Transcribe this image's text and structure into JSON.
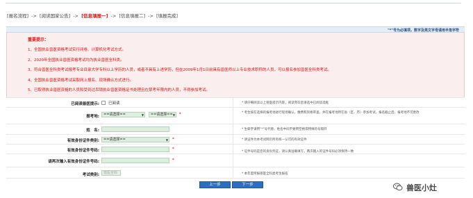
{
  "breadcrumb": {
    "steps": [
      {
        "label": "[报名流程]"
      },
      {
        "label": "[阅读国家公告]"
      },
      {
        "label": "[信息填报一]"
      },
      {
        "label": "[信息填报二]"
      },
      {
        "label": "[填报完成]"
      }
    ],
    "separator": "->",
    "active_index": 2
  },
  "notice": {
    "text": "\"*\"号为必填项，数字及英文字母请用半角字符"
  },
  "prompt": {
    "title": "重要提示：",
    "items": [
      "1、全国执业兽医资格考试实行闭卷、计算机化考试方式。",
      "2、2020年全国执业兽医资格考试均为执业兽医全科类。",
      "3、符合兽医全科类考试报考专业目录大学专科以上学历的人员，或者不具有上述学历，但在2009年1月1日前具有兽医师以上专业技术职称的人员，可以报名参加兽医全科类考试。",
      "4、全国执业兽医资格考试采取网上报名、现场确认方式进行。",
      "5、已取得执业兽医资格的人员和受到过吊销执业兽医资格证书处理且在禁考年限内的人员，不得参加考试。"
    ]
  },
  "form": {
    "agree": {
      "label": "已阅读兽医提示:",
      "option": "已阅读",
      "note": "* 请仔细阅读以上兽医提示内容，阅读完毕后请选中已阅读选框"
    },
    "exam_site": {
      "label": "报考地:",
      "province": "==请选择==",
      "city": "==请选择==",
      "note": "* 考生按在选择的报考地进行现场确认，缴费和资格审查，并在报考地所在省（区、市）参加考试，报名截止后，报考地不可更改"
    },
    "name": {
      "label": "姓　名:",
      "value": "",
      "note": "* 生僻字请用\"*\"号代替，姓名中间不要用空格或特殊符号隔开"
    },
    "id_type": {
      "label": "有效身份证件类别:",
      "value": "==请选择==",
      "note": "* 请证件为本考试网页所有统一认可的有效证件"
    },
    "id_number": {
      "label": "有效身份证件号码:",
      "value": ""
    },
    "id_number_confirm": {
      "label": "请再次输入有效身份证件号码:",
      "value": "",
      "note": "* 证件号码是您的身份凭证，请认真准确填写，两次输入的证件号码必须保持一致"
    },
    "exam_category": {
      "label": "考试类别:",
      "value": "兽医全科",
      "note": "* 本年度所报兽医全科类考生报名"
    }
  },
  "buttons": {
    "prev": "上一步",
    "next": "下一步"
  },
  "watermark": {
    "text": "兽医小灶"
  },
  "colors": {
    "accent_blue": "#2c6fc2",
    "alert_red": "#dd1111",
    "prompt_bg": "#fbeeee",
    "input_bg": "#dceedd"
  }
}
